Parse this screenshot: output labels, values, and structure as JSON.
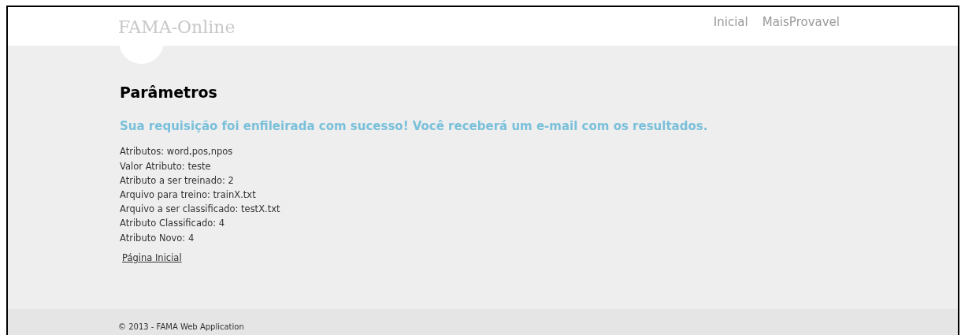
{
  "header": {
    "logo": "FAMA-Online",
    "nav": [
      {
        "label": "Inicial"
      },
      {
        "label": "MaisProvavel"
      }
    ]
  },
  "main": {
    "title": "Parâmetros",
    "message": "Sua requisição foi enfileirada com sucesso! Você receberá um e-mail com os resultados.",
    "lines": [
      "Atributos: word,pos,npos",
      "Valor Atributo: teste",
      "Atributo a ser treinado: 2",
      "Arquivo para treino: trainX.txt",
      "Arquivo a ser classificado: testX.txt",
      "Atributo Classificado: 4",
      "Atributo Novo: 4"
    ],
    "link": "Página Inicial"
  },
  "footer": {
    "text": "© 2013 - FAMA Web Application"
  }
}
